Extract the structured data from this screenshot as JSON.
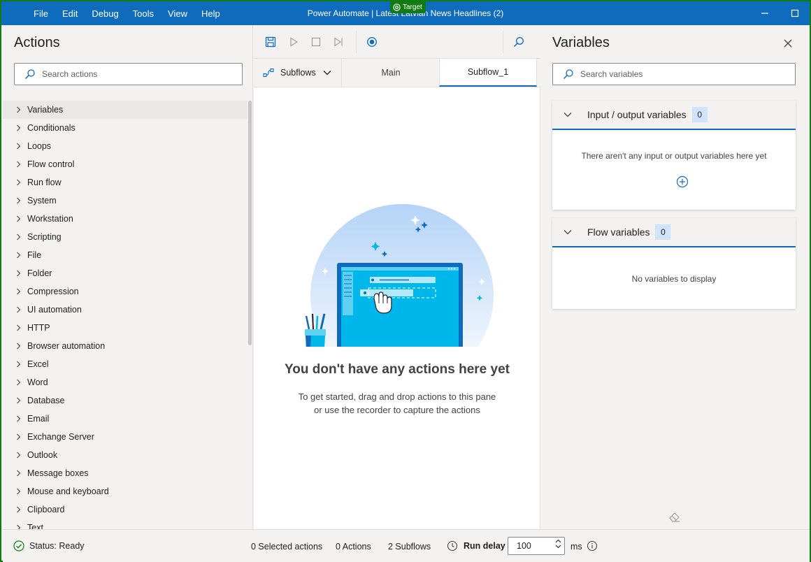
{
  "window": {
    "title": "Power Automate | Latest Latvian News Headlines (2)",
    "target_badge": "Target",
    "menu": [
      "File",
      "Edit",
      "Debug",
      "Tools",
      "View",
      "Help"
    ]
  },
  "actions_panel": {
    "title": "Actions",
    "search_placeholder": "Search actions",
    "items": [
      "Variables",
      "Conditionals",
      "Loops",
      "Flow control",
      "Run flow",
      "System",
      "Workstation",
      "Scripting",
      "File",
      "Folder",
      "Compression",
      "UI automation",
      "HTTP",
      "Browser automation",
      "Excel",
      "Word",
      "Database",
      "Email",
      "Exchange Server",
      "Outlook",
      "Message boxes",
      "Mouse and keyboard",
      "Clipboard",
      "Text"
    ]
  },
  "designer": {
    "subflows_label": "Subflows",
    "tabs": [
      "Main",
      "Subflow_1"
    ],
    "active_tab": "Subflow_1",
    "empty_title": "You don't have any actions here yet",
    "empty_line1": "To get started, drag and drop actions to this pane",
    "empty_line2": "or use the recorder to capture the actions"
  },
  "variables_panel": {
    "title": "Variables",
    "search_placeholder": "Search variables",
    "io_section": {
      "title": "Input / output variables",
      "count": "0",
      "empty_text": "There aren't any input or output variables here yet"
    },
    "flow_section": {
      "title": "Flow variables",
      "count": "0",
      "empty_text": "No variables to display"
    }
  },
  "statusbar": {
    "status": "Status: Ready",
    "selected_actions": "0 Selected actions",
    "actions": "0 Actions",
    "subflows": "2 Subflows",
    "run_delay_label": "Run delay",
    "run_delay_value": "100",
    "unit": "ms"
  },
  "colors": {
    "accent": "#0f6cbd",
    "frame": "#107c10",
    "panel_bg": "#f3f2f1"
  }
}
